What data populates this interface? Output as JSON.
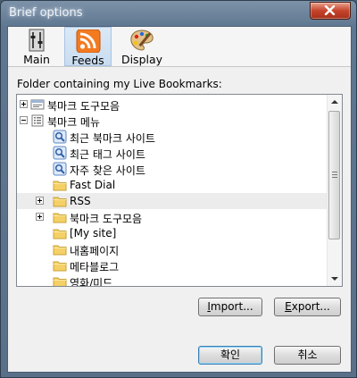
{
  "window": {
    "title": "Brief options"
  },
  "toolbar": {
    "panes": [
      {
        "label": "Main",
        "icon": "main-settings-icon",
        "selected": false
      },
      {
        "label": "Feeds",
        "icon": "rss-feed-icon",
        "selected": true
      },
      {
        "label": "Display",
        "icon": "palette-icon",
        "selected": false
      }
    ]
  },
  "feeds": {
    "folder_label": "Folder containing my Live Bookmarks:",
    "tree": [
      {
        "label": "북마크 도구모음",
        "icon": "bookmark-toolbar-icon",
        "expander": "plus",
        "level": 0
      },
      {
        "label": "북마크 메뉴",
        "icon": "bookmark-menu-icon",
        "expander": "minus",
        "level": 0
      },
      {
        "label": "최근 북마크 사이트",
        "icon": "smart-query-icon",
        "expander": "none",
        "level": 1
      },
      {
        "label": "최근 태그 사이트",
        "icon": "smart-query-icon",
        "expander": "none",
        "level": 1
      },
      {
        "label": "자주 찾은 사이트",
        "icon": "smart-query-icon",
        "expander": "none",
        "level": 1
      },
      {
        "label": "Fast Dial",
        "icon": "folder-icon",
        "expander": "none",
        "level": 1
      },
      {
        "label": "RSS",
        "icon": "folder-icon",
        "expander": "plus",
        "level": 1
      },
      {
        "label": "북마크 도구모음",
        "icon": "folder-icon",
        "expander": "plus",
        "level": 1
      },
      {
        "label": "[My site]",
        "icon": "folder-icon",
        "expander": "none",
        "level": 1
      },
      {
        "label": "내홈페이지",
        "icon": "folder-icon",
        "expander": "none",
        "level": 1
      },
      {
        "label": "메타블로그",
        "icon": "folder-icon",
        "expander": "none",
        "level": 1
      },
      {
        "label": "영화/미드",
        "icon": "folder-icon",
        "expander": "none",
        "level": 1
      }
    ],
    "import_pre": "",
    "import_key": "I",
    "import_post": "mport...",
    "export_pre": "",
    "export_key": "E",
    "export_post": "xport..."
  },
  "dialog": {
    "ok_label": "확인",
    "cancel_label": "취소"
  },
  "colors": {
    "selected_pane": "#c9dcf0",
    "folder": "#f5d067",
    "rss": "#f47a20"
  }
}
